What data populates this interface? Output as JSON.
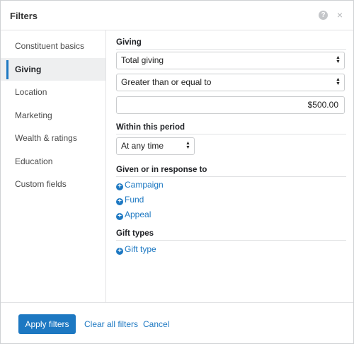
{
  "header": {
    "title": "Filters",
    "help_glyph": "?",
    "close_glyph": "×"
  },
  "sidebar": {
    "items": [
      {
        "label": "Constituent basics",
        "active": false
      },
      {
        "label": "Giving",
        "active": true
      },
      {
        "label": "Location",
        "active": false
      },
      {
        "label": "Marketing",
        "active": false
      },
      {
        "label": "Wealth & ratings",
        "active": false
      },
      {
        "label": "Education",
        "active": false
      },
      {
        "label": "Custom fields",
        "active": false
      }
    ]
  },
  "giving": {
    "heading": "Giving",
    "type_value": "Total giving",
    "comparison_value": "Greater than or equal to",
    "amount_value": "$500.00"
  },
  "period": {
    "heading": "Within this period",
    "value": "At any time"
  },
  "given_in_response": {
    "heading": "Given or in response to",
    "links": [
      "Campaign",
      "Fund",
      "Appeal"
    ]
  },
  "gift_types": {
    "heading": "Gift types",
    "link": "Gift type"
  },
  "footer": {
    "apply_label": "Apply filters",
    "clear_label": "Clear all filters",
    "cancel_label": "Cancel"
  },
  "colors": {
    "accent": "#1d78c2",
    "active_bg": "#eeeff0",
    "border": "#e1e2e4"
  },
  "icons": {
    "help": "help-icon",
    "close": "close-icon",
    "add": "plus-circle-icon",
    "select_arrow": "sort-arrows-icon"
  }
}
